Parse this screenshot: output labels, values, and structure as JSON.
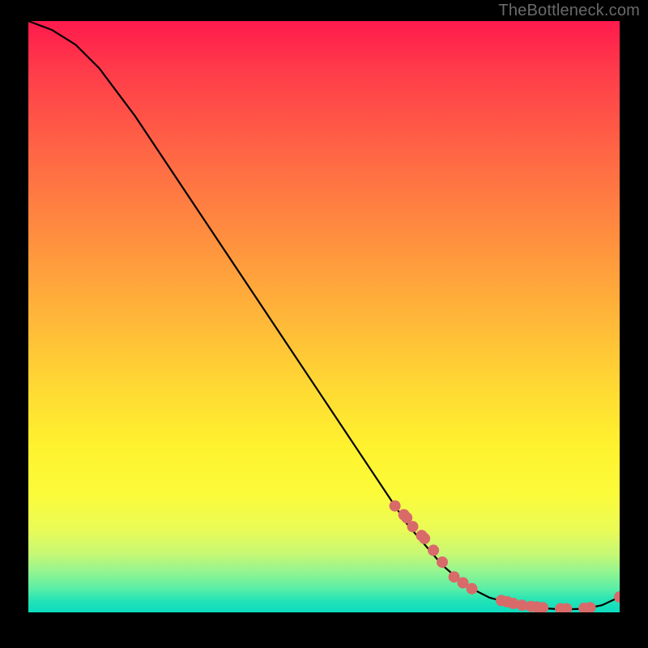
{
  "watermark": "TheBottleneck.com",
  "chart_data": {
    "type": "line",
    "title": "",
    "xlabel": "",
    "ylabel": "",
    "xlim": [
      0,
      100
    ],
    "ylim": [
      0,
      100
    ],
    "grid": false,
    "legend": false,
    "series": [
      {
        "name": "curve",
        "x": [
          0,
          4,
          8,
          12,
          18,
          26,
          34,
          42,
          50,
          58,
          64,
          70,
          74,
          78,
          82,
          86,
          90,
          94,
          97,
          100
        ],
        "y": [
          100,
          98.5,
          96,
          92,
          84,
          72,
          60,
          48,
          36,
          24,
          15,
          8,
          4.5,
          2.5,
          1.4,
          0.8,
          0.5,
          0.6,
          1.2,
          2.6
        ]
      }
    ],
    "markers": {
      "name": "bottleneck-points",
      "x": [
        62,
        63.5,
        64,
        65,
        66.5,
        67,
        68.5,
        70,
        72,
        73.5,
        75,
        80,
        81,
        82,
        83.5,
        85,
        86,
        87,
        90,
        91,
        94,
        95,
        100
      ],
      "y": [
        18,
        16.5,
        16,
        14.5,
        13,
        12.5,
        10.5,
        8.5,
        6,
        5,
        4,
        2,
        1.8,
        1.5,
        1.2,
        1,
        0.9,
        0.8,
        0.6,
        0.6,
        0.7,
        0.8,
        2.6
      ]
    },
    "gradient_stops": [
      {
        "pos": 0,
        "color": "#ff1a4d"
      },
      {
        "pos": 50,
        "color": "#ffb639"
      },
      {
        "pos": 80,
        "color": "#fbfb3a"
      },
      {
        "pos": 100,
        "color": "#0bdcbf"
      }
    ]
  }
}
